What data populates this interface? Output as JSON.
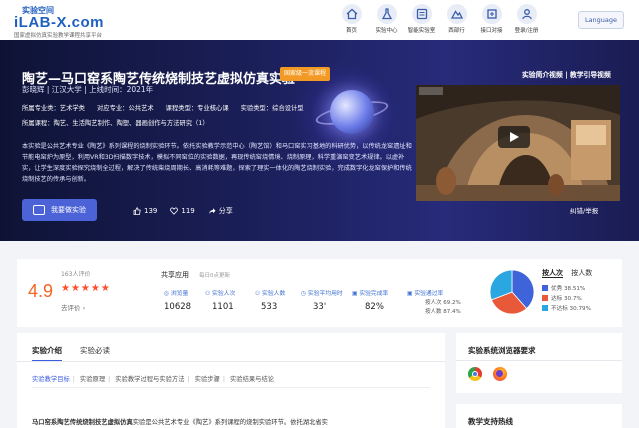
{
  "header": {
    "logo_top": "实验空间",
    "logo_main": "iLAB-X.com",
    "logo_sub": "国家虚拟仿真实验教学课程共享平台",
    "nav": [
      {
        "label": "首页",
        "icon": "home-icon"
      },
      {
        "label": "实验中心",
        "icon": "flask-icon"
      },
      {
        "label": "智能实验室",
        "icon": "lab-icon"
      },
      {
        "label": "西部行",
        "icon": "mountain-icon"
      },
      {
        "label": "接口对接",
        "icon": "plug-icon"
      },
      {
        "label": "登录/注册",
        "icon": "user-icon"
      }
    ],
    "language": "Language"
  },
  "hero": {
    "title": "陶艺—马口窑系陶艺传统烧制技艺虚拟仿真实验",
    "badge": "国家级一流课程",
    "author": "彭晓辉 | 江汉大学 | 上线时间：2021年",
    "meta": [
      "所属专业类：艺术学类",
      "对应专业：公共艺术",
      "课程类型：专业核心课",
      "实验类型：综合设计型"
    ],
    "course": "所属课程：陶艺、生活陶艺制作、陶塑、器画创作与方法研究（1）",
    "description": "本实验是公共艺术专业《陶艺》系列课程的烧制实验环节。依托实验教学示范中心（陶艺馆）和马口窑实习基地的科研优势，以传统龙窑遗址和节能电窑炉为原型，利用VR和3D扫描数字技术，模拟不同窑位的实验数据，再现传统窑烧情境、烧制原理，科学重演窑变艺术规律。以虚补实，让学生深度实验探究烧制全过程，解决了传统柴烧周期长、高消耗等难题，探索了理实一体化的陶艺烧制实验，完成数字化龙窑保护和传统烧制技艺的传承与创新。",
    "start_button": "我要做实验",
    "likes": "139",
    "favorites": "119",
    "share": "分享",
    "tabs": "实验简介视频 | 教学引导视频",
    "report": "纠错/举报"
  },
  "rating": {
    "score": "4.9",
    "count": "163人评价",
    "stars": "★★★★★",
    "go_rate": "去评价 ›"
  },
  "share_app": {
    "title": "共享应用",
    "subtitle": "每日0点更新",
    "metrics": [
      {
        "label": "浏览量",
        "value": "10628"
      },
      {
        "label": "实验人次",
        "value": "1101"
      },
      {
        "label": "实验人数",
        "value": "533"
      },
      {
        "label": "实验平均用时",
        "value": "33'"
      },
      {
        "label": "实验完成率",
        "value": "82%"
      },
      {
        "label": "实验通过率",
        "value": ""
      }
    ],
    "pass_by_person_time": "按人次 69.2%",
    "pass_by_person_count": "按人数 87.4%"
  },
  "chart_data": {
    "type": "pie",
    "categories": [
      "优秀",
      "达标",
      "不达标"
    ],
    "values": [
      38.51,
      30.7,
      30.79
    ],
    "colors": [
      "#3f64d9",
      "#e8593a",
      "#2aa6e0"
    ]
  },
  "legend": {
    "tab_active": "按人次",
    "tab_inactive": "按人数",
    "items": [
      "优秀 38.51%",
      "达标 30.7%",
      "不达标 30.79%"
    ]
  },
  "main": {
    "tabs": [
      "实验介绍",
      "实验必读"
    ],
    "subtabs": [
      "实验教学目标",
      "实验原理",
      "实验教学过程与实验方法",
      "实验步骤",
      "实验结果与结论"
    ],
    "intro_bold": "马口窑系陶艺传统烧制技艺虚拟仿真",
    "intro_rest": "实验是公共艺术专业《陶艺》系列课程的烧制实验环节。依托湖北省实"
  },
  "side": {
    "browser_title": "实验系统浏览器要求",
    "support_title": "教学支持热线"
  }
}
